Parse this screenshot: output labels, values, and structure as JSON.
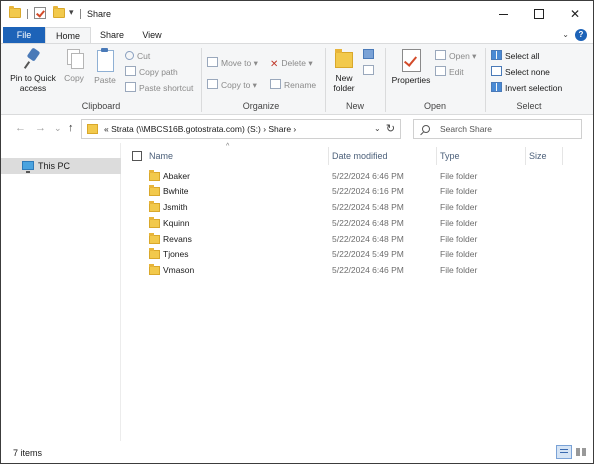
{
  "window": {
    "title": "Share",
    "controls": {
      "minimize": "",
      "maximize": "",
      "close": "✕"
    }
  },
  "quick_access": {
    "dropdown": "▾"
  },
  "ribbon_tabs": [
    "File",
    "Home",
    "Share",
    "View"
  ],
  "ribbon": {
    "collapse": "⌄",
    "help": "?",
    "clipboard": {
      "label": "Clipboard",
      "pin": "Pin to Quick access",
      "copy": "Copy",
      "paste": "Paste",
      "cut": "Cut",
      "copy_path": "Copy path",
      "paste_shortcut": "Paste shortcut"
    },
    "organize": {
      "label": "Organize",
      "move_to": "Move to ▾",
      "copy_to": "Copy to ▾",
      "delete": "Delete ▾",
      "rename": "Rename"
    },
    "new": {
      "label": "New",
      "new_folder": "New folder"
    },
    "open": {
      "label": "Open",
      "properties": "Properties",
      "open": "Open ▾",
      "edit": "Edit"
    },
    "select": {
      "label": "Select",
      "select_all": "Select all",
      "select_none": "Select none",
      "invert": "Invert selection"
    }
  },
  "nav": {
    "back": "←",
    "forward": "→",
    "recent": "⌄",
    "up": "↑",
    "address": "«  Strata (\\\\MBCS16B.gotostrata.com) (S:)  ›  Share  ›",
    "address_dropdown": "⌄",
    "refresh": "↻",
    "search_placeholder": "Search Share"
  },
  "navpane": {
    "this_pc": "This PC"
  },
  "list": {
    "sort_indicator": "^",
    "columns": {
      "name": "Name",
      "date": "Date modified",
      "type": "Type",
      "size": "Size"
    },
    "rows": [
      {
        "name": "Abaker",
        "date": "5/22/2024 6:46 PM",
        "type": "File folder"
      },
      {
        "name": "Bwhite",
        "date": "5/22/2024 6:16 PM",
        "type": "File folder"
      },
      {
        "name": "Jsmith",
        "date": "5/22/2024 5:48 PM",
        "type": "File folder"
      },
      {
        "name": "Kquinn",
        "date": "5/22/2024 6:48 PM",
        "type": "File folder"
      },
      {
        "name": "Revans",
        "date": "5/22/2024 6:48 PM",
        "type": "File folder"
      },
      {
        "name": "Tjones",
        "date": "5/22/2024 5:49 PM",
        "type": "File folder"
      },
      {
        "name": "Vmason",
        "date": "5/22/2024 6:46 PM",
        "type": "File folder"
      }
    ]
  },
  "status": {
    "count": "7 items"
  }
}
